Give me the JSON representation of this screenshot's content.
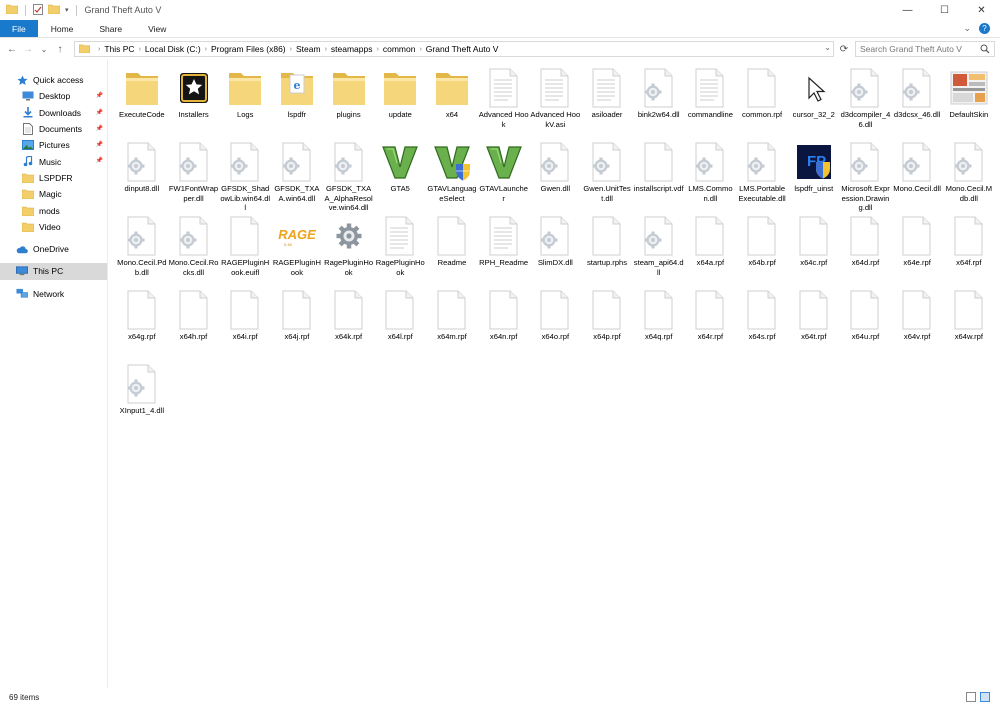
{
  "window": {
    "title": "Grand Theft Auto V",
    "controls": [
      "—",
      "☐",
      "✕"
    ]
  },
  "ribbon": {
    "tabs": [
      "File",
      "Home",
      "Share",
      "View"
    ]
  },
  "nav": {
    "back": "←",
    "forward": "→",
    "recent": "⌄",
    "up": "↑",
    "crumbs": [
      "This PC",
      "Local Disk (C:)",
      "Program Files (x86)",
      "Steam",
      "steamapps",
      "common",
      "Grand Theft Auto V"
    ],
    "refresh": "⟳",
    "search_placeholder": "Search Grand Theft Auto V"
  },
  "sidebar": {
    "items": [
      {
        "label": "Quick access",
        "icon": "star-icon",
        "pinned": false
      },
      {
        "label": "Desktop",
        "icon": "desktop-icon",
        "pinned": true
      },
      {
        "label": "Downloads",
        "icon": "download-icon",
        "pinned": true
      },
      {
        "label": "Documents",
        "icon": "documents-icon",
        "pinned": true
      },
      {
        "label": "Pictures",
        "icon": "pictures-icon",
        "pinned": true
      },
      {
        "label": "Music",
        "icon": "music-icon",
        "pinned": true
      },
      {
        "label": "LSPDFR",
        "icon": "folder-icon",
        "pinned": false
      },
      {
        "label": "Magic",
        "icon": "folder-icon",
        "pinned": false
      },
      {
        "label": "mods",
        "icon": "folder-icon",
        "pinned": false
      },
      {
        "label": "Video",
        "icon": "folder-icon",
        "pinned": false
      },
      {
        "label": "OneDrive",
        "icon": "cloud-icon",
        "pinned": false
      },
      {
        "label": "This PC",
        "icon": "pc-icon",
        "pinned": false,
        "selected": true
      },
      {
        "label": "Network",
        "icon": "network-icon",
        "pinned": false
      }
    ]
  },
  "files": [
    {
      "name": "ExecuteCode",
      "type": "folder"
    },
    {
      "name": "Installers",
      "type": "app-star"
    },
    {
      "name": "Logs",
      "type": "folder"
    },
    {
      "name": "lspdfr",
      "type": "folder-ie"
    },
    {
      "name": "plugins",
      "type": "folder"
    },
    {
      "name": "update",
      "type": "folder"
    },
    {
      "name": "x64",
      "type": "folder"
    },
    {
      "name": "Advanced Hook",
      "type": "doc"
    },
    {
      "name": "Advanced HookV.asi",
      "type": "doc"
    },
    {
      "name": "asiloader",
      "type": "doc"
    },
    {
      "name": "bink2w64.dll",
      "type": "dll"
    },
    {
      "name": "commandline",
      "type": "doc"
    },
    {
      "name": "common.rpf",
      "type": "blank"
    },
    {
      "name": "cursor_32_2",
      "type": "cursor"
    },
    {
      "name": "d3dcompiler_46.dll",
      "type": "dll"
    },
    {
      "name": "d3dcsx_46.dll",
      "type": "dll"
    },
    {
      "name": "DefaultSkin",
      "type": "image"
    },
    {
      "name": "dinput8.dll",
      "type": "dll"
    },
    {
      "name": "FW1FontWrapper.dll",
      "type": "dll"
    },
    {
      "name": "GFSDK_ShadowLib.win64.dll",
      "type": "dll"
    },
    {
      "name": "GFSDK_TXAA.win64.dll",
      "type": "dll"
    },
    {
      "name": "GFSDK_TXAA_AlphaResolve.win64.dll",
      "type": "dll"
    },
    {
      "name": "GTA5",
      "type": "gtav"
    },
    {
      "name": "GTAVLanguageSelect",
      "type": "gtav-shield"
    },
    {
      "name": "GTAVLauncher",
      "type": "gtav"
    },
    {
      "name": "Gwen.dll",
      "type": "dll"
    },
    {
      "name": "Gwen.UnitTest.dll",
      "type": "dll"
    },
    {
      "name": "installscript.vdf",
      "type": "blank"
    },
    {
      "name": "LMS.Common.dll",
      "type": "dll"
    },
    {
      "name": "LMS.PortableExecutable.dll",
      "type": "dll"
    },
    {
      "name": "lspdfr_uinst",
      "type": "fp"
    },
    {
      "name": "Microsoft.Expression.Drawing.dll",
      "type": "dll"
    },
    {
      "name": "Mono.Cecil.dll",
      "type": "dll"
    },
    {
      "name": "Mono.Cecil.Mdb.dll",
      "type": "dll"
    },
    {
      "name": "Mono.Cecil.Pdb.dll",
      "type": "dll"
    },
    {
      "name": "Mono.Cecil.Rocks.dll",
      "type": "dll"
    },
    {
      "name": "RAGEPluginHook.euifl",
      "type": "blank"
    },
    {
      "name": "RAGEPluginHook",
      "type": "rage"
    },
    {
      "name": "RagePluginHook",
      "type": "gear"
    },
    {
      "name": "RagePluginHook",
      "type": "doc"
    },
    {
      "name": "Readme",
      "type": "blank"
    },
    {
      "name": "RPH_Readme",
      "type": "doc"
    },
    {
      "name": "SlimDX.dll",
      "type": "dll"
    },
    {
      "name": "startup.rphs",
      "type": "blank"
    },
    {
      "name": "steam_api64.dll",
      "type": "dll"
    },
    {
      "name": "x64a.rpf",
      "type": "blank"
    },
    {
      "name": "x64b.rpf",
      "type": "blank"
    },
    {
      "name": "x64c.rpf",
      "type": "blank"
    },
    {
      "name": "x64d.rpf",
      "type": "blank"
    },
    {
      "name": "x64e.rpf",
      "type": "blank"
    },
    {
      "name": "x64f.rpf",
      "type": "blank"
    },
    {
      "name": "x64g.rpf",
      "type": "blank"
    },
    {
      "name": "x64h.rpf",
      "type": "blank"
    },
    {
      "name": "x64i.rpf",
      "type": "blank"
    },
    {
      "name": "x64j.rpf",
      "type": "blank"
    },
    {
      "name": "x64k.rpf",
      "type": "blank"
    },
    {
      "name": "x64l.rpf",
      "type": "blank"
    },
    {
      "name": "x64m.rpf",
      "type": "blank"
    },
    {
      "name": "x64n.rpf",
      "type": "blank"
    },
    {
      "name": "x64o.rpf",
      "type": "blank"
    },
    {
      "name": "x64p.rpf",
      "type": "blank"
    },
    {
      "name": "x64q.rpf",
      "type": "blank"
    },
    {
      "name": "x64r.rpf",
      "type": "blank"
    },
    {
      "name": "x64s.rpf",
      "type": "blank"
    },
    {
      "name": "x64t.rpf",
      "type": "blank"
    },
    {
      "name": "x64u.rpf",
      "type": "blank"
    },
    {
      "name": "x64v.rpf",
      "type": "blank"
    },
    {
      "name": "x64w.rpf",
      "type": "blank"
    },
    {
      "name": "XInput1_4.dll",
      "type": "dll"
    }
  ],
  "status": {
    "item_count": "69 items"
  },
  "colors": {
    "accent": "#1979ca",
    "folder": "#f3cf6b",
    "folder_dark": "#e0b440",
    "gtav_green": "#4e9a2e"
  }
}
